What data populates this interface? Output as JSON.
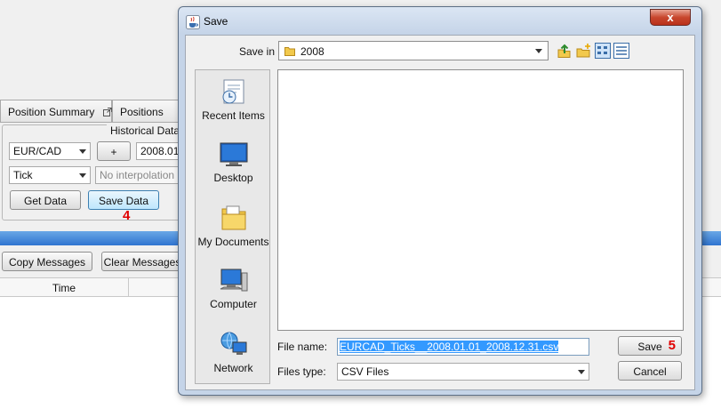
{
  "app": {
    "tabs": [
      {
        "label": "Position Summary"
      },
      {
        "label": "Positions"
      }
    ],
    "historical": {
      "title": "Historical Data",
      "instrument": "EUR/CAD",
      "plus_label": "+",
      "date_value": "2008.01.",
      "period": "Tick",
      "interpolation_placeholder": "No interpolation",
      "get_data_label": "Get Data",
      "save_data_label": "Save Data",
      "step_label": "4"
    },
    "copy_messages_label": "Copy Messages",
    "clear_messages_label": "Clear Messages",
    "time_header": "Time"
  },
  "dialog": {
    "title": "Save",
    "close_label": "x",
    "save_in_label": "Save in",
    "save_in_value": "2008",
    "places": [
      {
        "label": "Recent Items",
        "icon": "recent-items-icon"
      },
      {
        "label": "Desktop",
        "icon": "desktop-icon"
      },
      {
        "label": "My Documents",
        "icon": "my-documents-icon"
      },
      {
        "label": "Computer",
        "icon": "computer-icon"
      },
      {
        "label": "Network",
        "icon": "network-icon"
      }
    ],
    "file_name_label": "File name:",
    "file_name_value": "EURCAD_Ticks__2008.01.01_2008.12.31.csv",
    "files_type_label": "Files type:",
    "files_type_value": "CSV Files",
    "save_label": "Save",
    "save_step_label": "5",
    "cancel_label": "Cancel"
  },
  "colors": {
    "progress": "#2f74d0",
    "step_marker": "#e00000",
    "selection": "#3399ff"
  }
}
